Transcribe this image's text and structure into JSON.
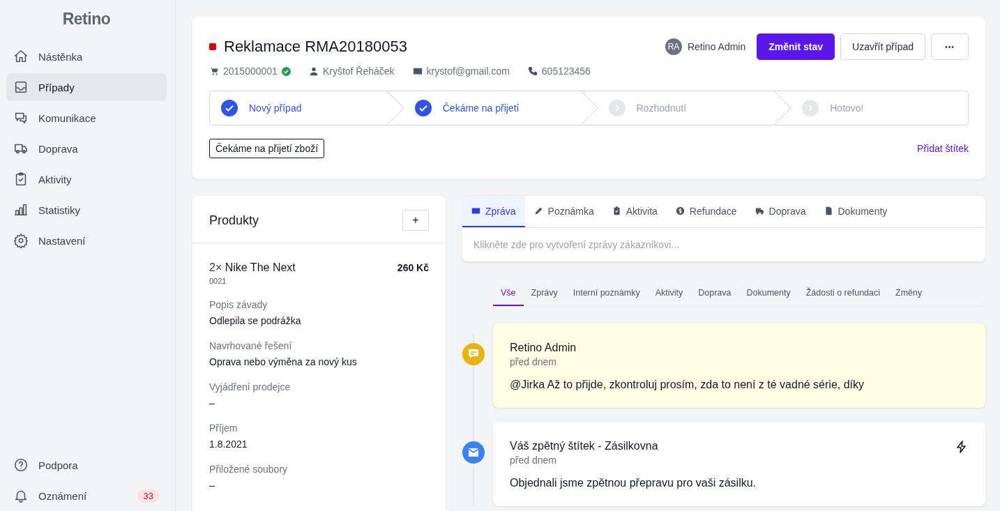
{
  "sidebar": {
    "logo": "Retino",
    "items": [
      {
        "label": "Nástěnka",
        "selected": false
      },
      {
        "label": "Případy",
        "selected": true
      },
      {
        "label": "Komunikace",
        "selected": false
      },
      {
        "label": "Doprava",
        "selected": false
      },
      {
        "label": "Aktivity",
        "selected": false
      },
      {
        "label": "Statistiky",
        "selected": false
      },
      {
        "label": "Nastavení",
        "selected": false
      }
    ],
    "bottom_items": [
      {
        "label": "Podpora"
      },
      {
        "label": "Oznámení",
        "badge": "33"
      }
    ]
  },
  "case": {
    "title": "Reklamace RMA20180053",
    "order": "2015000001",
    "order_verified": true,
    "customer": "Kryštof Řeháček",
    "email": "krystof@gmail.com",
    "phone": "605123456",
    "assignee": {
      "initials": "RA",
      "name": "Retino Admin"
    },
    "buttons": [
      {
        "label": "Změnit stav",
        "kind": "primary"
      },
      {
        "label": "Uzavřít případ",
        "kind": "secondary"
      },
      {
        "label": "•••",
        "kind": "more"
      }
    ],
    "steps": [
      {
        "label": "Nový případ",
        "done": true
      },
      {
        "label": "Čekáme na přijetí",
        "done": true
      },
      {
        "label": "Rozhodnutí",
        "done": false
      },
      {
        "label": "Hotovo!",
        "done": false
      }
    ],
    "tag": "Čekáme na přijetí zboží",
    "add_tag": "Přidat štítek"
  },
  "products": {
    "title": "Produkty",
    "add_button": "+",
    "item": {
      "quantity": "2×",
      "name": "Nike The Next",
      "code": "0021",
      "price": "260 Kč"
    },
    "fields": [
      {
        "label": "Popis závady",
        "value": "Odlepila se podrážka"
      },
      {
        "label": "Navrhované řešení",
        "value": "Oprava nebo výměna za nový kus"
      },
      {
        "label": "Vyjádření prodejce",
        "value": "–"
      },
      {
        "label": "Příjem",
        "value": "1.8.2021"
      },
      {
        "label": "Přiložené soubory",
        "value": "–"
      }
    ]
  },
  "composer": {
    "tabs": [
      {
        "label": "Zpráva",
        "selected": true
      },
      {
        "label": "Poznámka",
        "selected": false
      },
      {
        "label": "Aktivita",
        "selected": false
      },
      {
        "label": "Refundace",
        "selected": false
      },
      {
        "label": "Doprava",
        "selected": false
      },
      {
        "label": "Dokumenty",
        "selected": false
      }
    ],
    "placeholder": "Klikněte zde pro vytvoření zprávy zákazníkovi..."
  },
  "filters": [
    {
      "label": "Vše",
      "selected": true
    },
    {
      "label": "Zprávy",
      "selected": false
    },
    {
      "label": "Interní poznámky",
      "selected": false
    },
    {
      "label": "Aktivity",
      "selected": false
    },
    {
      "label": "Doprava",
      "selected": false
    },
    {
      "label": "Dokumenty",
      "selected": false
    },
    {
      "label": "Žádosti o refundaci",
      "selected": false
    },
    {
      "label": "Změny",
      "selected": false
    }
  ],
  "timeline": [
    {
      "kind": "note",
      "author": "Retino Admin",
      "time": "před dnem",
      "text": "@Jirka Až to přijde, zkontroluj prosím, zda to není z té vadné série, díky",
      "automated": false
    },
    {
      "kind": "message",
      "author": "Váš zpětný štítek - Zásilkovna",
      "time": "před dnem",
      "text": "Objednali jsme zpětnou přepravu pro vaši zásilku.",
      "automated": true
    }
  ]
}
